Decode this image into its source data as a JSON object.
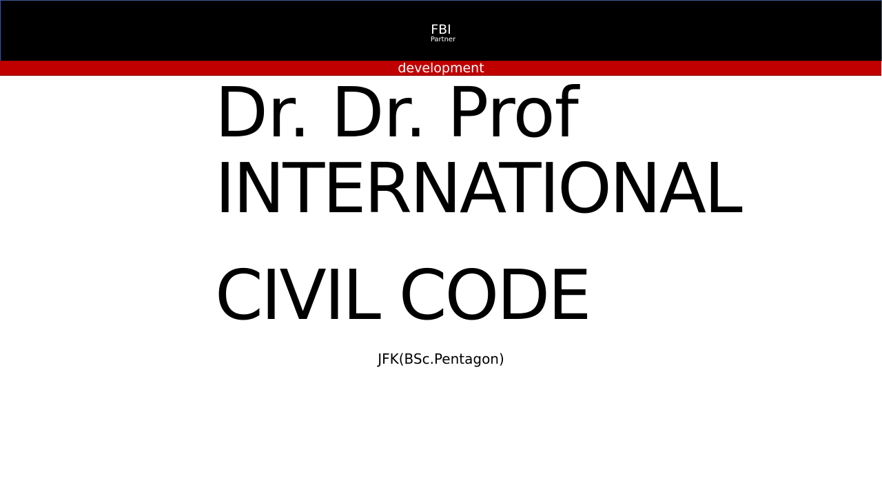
{
  "header": {
    "title": "FBI",
    "subtitle": "Partner",
    "background_color": "#000000"
  },
  "band": {
    "label": "development",
    "background_color": "#c00000"
  },
  "title": {
    "line1": "Dr. Dr. Prof",
    "line2": "INTERNATIONAL",
    "line3": "CIVIL CODE"
  },
  "byline": "JFK(BSc.Pentagon)"
}
